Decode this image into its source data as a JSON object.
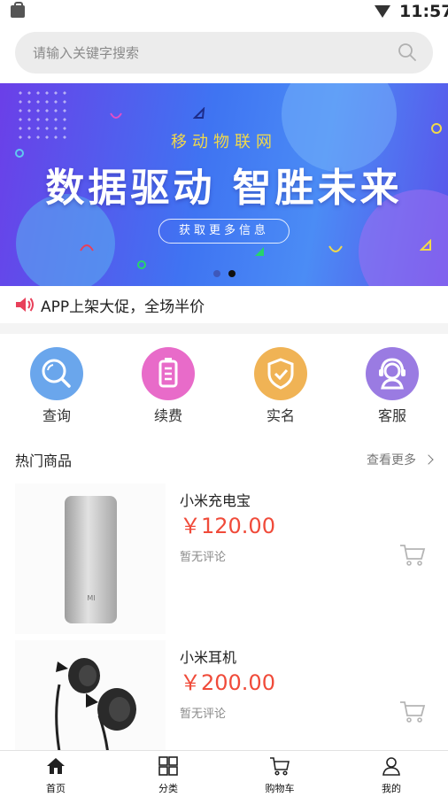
{
  "status_bar": {
    "time": "11:57"
  },
  "search": {
    "placeholder": "请输入关键字搜索",
    "value": ""
  },
  "banner": {
    "subtitle": "移动物联网",
    "headline": "数据驱动  智胜未来",
    "button_label": "获取更多信息",
    "page_indicator": {
      "count": 2,
      "active_index": 1
    }
  },
  "notice": {
    "text": "APP上架大促，全场半价"
  },
  "quick_actions": [
    {
      "label": "查询",
      "icon": "search-icon",
      "color": "#6aa6ec"
    },
    {
      "label": "续费",
      "icon": "battery-icon",
      "color": "#e86bc9"
    },
    {
      "label": "实名",
      "icon": "shield-check-icon",
      "color": "#f0b355"
    },
    {
      "label": "客服",
      "icon": "headset-icon",
      "color": "#9a7be2"
    }
  ],
  "hot_products": {
    "title": "热门商品",
    "more_label": "查看更多",
    "items": [
      {
        "name": "小米充电宝",
        "price": "￥120.00",
        "reviews": "暂无评论"
      },
      {
        "name": "小米耳机",
        "price": "￥200.00",
        "reviews": "暂无评论"
      }
    ]
  },
  "tabbar": [
    {
      "label": "首页",
      "icon": "home-icon"
    },
    {
      "label": "分类",
      "icon": "grid-icon"
    },
    {
      "label": "购物车",
      "icon": "cart-icon"
    },
    {
      "label": "我的",
      "icon": "user-icon"
    }
  ],
  "colors": {
    "price": "#f04b3a",
    "banner_subtitle": "#f1d94a",
    "notice_icon": "#e8405a"
  }
}
